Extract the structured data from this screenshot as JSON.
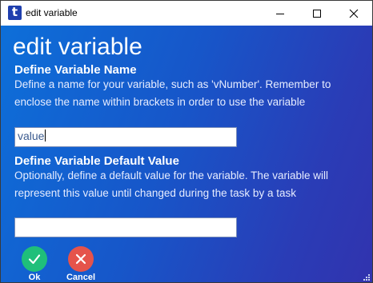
{
  "window": {
    "title": "edit variable",
    "app_icon_letter": "t",
    "controls": [
      "minimize-icon",
      "maximize-icon",
      "close-icon"
    ]
  },
  "main": {
    "heading": "edit variable",
    "name_section": {
      "title": "Define Variable Name",
      "description": "Define a name for your variable, such as 'vNumber'.  Remember to enclose the name within brackets in order to use the variable",
      "input_value": "value"
    },
    "default_section": {
      "title": "Define Variable Default Value",
      "description": "Optionally, define a default value for the variable.  The variable will represent this value until changed during the task by a task",
      "input_value": ""
    }
  },
  "actions": {
    "ok_label": "Ok",
    "ok_icon": "check-icon",
    "cancel_label": "Cancel",
    "cancel_icon": "x-icon"
  },
  "colors": {
    "gradient_start": "#0d6fd9",
    "gradient_end": "#3133ae",
    "ok": "#1fbf7a",
    "cancel": "#e5534b"
  }
}
